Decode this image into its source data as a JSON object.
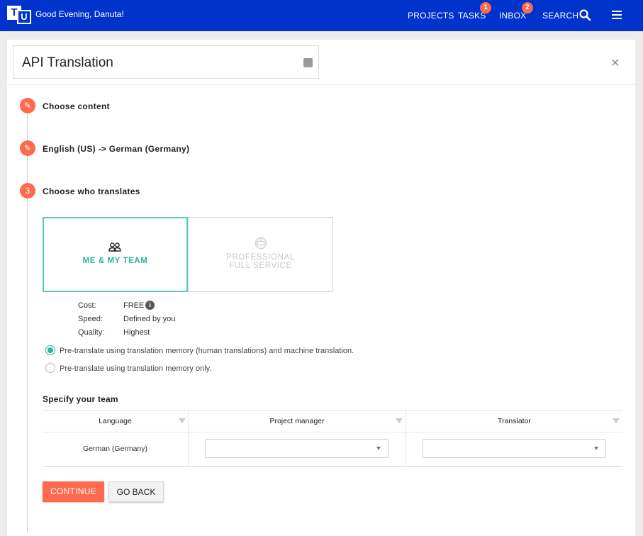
{
  "header": {
    "logo_t": "T",
    "logo_u": "U",
    "greeting": "Good Evening, Danuta!",
    "nav": {
      "projects": "PROJECTS",
      "tasks": "TASKS",
      "tasks_badge": "1",
      "inbox": "INBOX",
      "inbox_badge": "2",
      "search": "SEARCH"
    },
    "brand_color": "#0033cc",
    "accent_color": "#ff6a4d",
    "icons": [
      "search-icon",
      "hamburger-menu-icon"
    ]
  },
  "project": {
    "title": "API Translation",
    "close_glyph": "×"
  },
  "steps": [
    {
      "marker": "✎",
      "label": "Choose content"
    },
    {
      "marker": "✎",
      "label": "English (US) -> German (Germany)"
    },
    {
      "marker": "3",
      "label": "Choose who translates"
    }
  ],
  "service_options": {
    "me_team": {
      "label": "ME & MY TEAM",
      "selected": true
    },
    "professional": {
      "line1": "PROFESSIONAL",
      "line2": "FULL SERVICE",
      "selected": false
    }
  },
  "service_info": {
    "cost_label": "Cost:",
    "cost_value": "FREE",
    "speed_label": "Speed:",
    "speed_value": "Defined by you",
    "quality_label": "Quality:",
    "quality_value": "Highest"
  },
  "pretranslate": {
    "option1": "Pre-translate using translation memory (human translations) and machine translation.",
    "option2": "Pre-translate using translation memory only.",
    "selected": 1
  },
  "team": {
    "title": "Specify your team",
    "columns": [
      "Language",
      "Project manager",
      "Translator"
    ],
    "rows": [
      {
        "language": "German (Germany)",
        "project_manager": "",
        "translator": ""
      }
    ]
  },
  "actions": {
    "continue": "CONTINUE",
    "go_back": "GO BACK"
  },
  "teal_color": "#2bb3a3"
}
